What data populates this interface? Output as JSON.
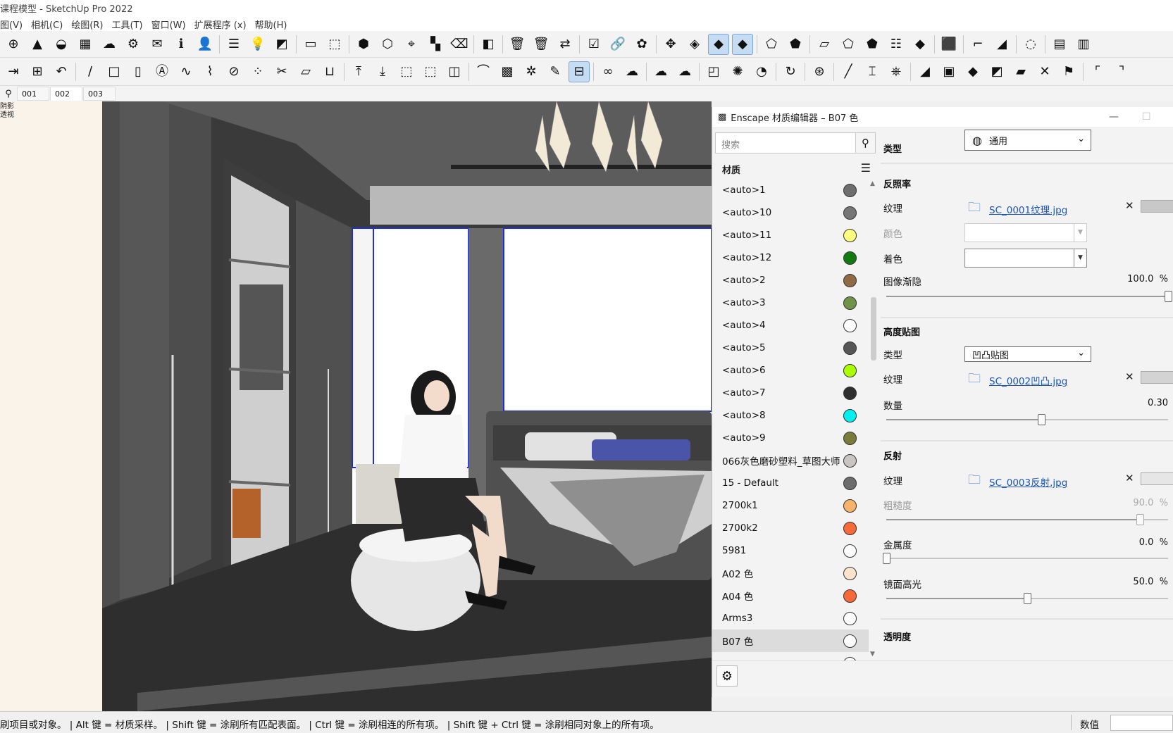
{
  "window": {
    "title": "课程模型 - SketchUp Pro 2022"
  },
  "menu": [
    "图(V)",
    "相机(C)",
    "绘图(R)",
    "工具(T)",
    "窗口(W)",
    "扩展程序 (x)",
    "帮助(H)"
  ],
  "toolbar1": [
    {
      "icon": "add-icon",
      "glyph": "⊕"
    },
    {
      "icon": "tree-icon",
      "glyph": "▲"
    },
    {
      "icon": "warehouse-icon",
      "glyph": "◒"
    },
    {
      "icon": "checker-icon",
      "glyph": "▦"
    },
    {
      "icon": "cloud-upload-icon",
      "glyph": "☁"
    },
    {
      "icon": "extension-gear-icon",
      "glyph": "⚙"
    },
    {
      "icon": "mail-icon",
      "glyph": "✉"
    },
    {
      "icon": "info-icon",
      "glyph": "ℹ"
    },
    {
      "icon": "user-icon",
      "glyph": "👤"
    },
    {
      "sep": true
    },
    {
      "icon": "list-icon",
      "glyph": "☰"
    },
    {
      "icon": "bulb-icon",
      "glyph": "💡"
    },
    {
      "icon": "contrast-icon",
      "glyph": "◩"
    },
    {
      "sep": true
    },
    {
      "icon": "rect-view-icon",
      "glyph": "▭"
    },
    {
      "icon": "frame-icon",
      "glyph": "⬚"
    },
    {
      "sep": true
    },
    {
      "icon": "hexagon-gold-icon",
      "glyph": "⬢"
    },
    {
      "icon": "hexagon-outline-icon",
      "glyph": "⬡"
    },
    {
      "icon": "point-icon",
      "glyph": "⌖"
    },
    {
      "icon": "components-icon",
      "glyph": "▚"
    },
    {
      "icon": "erase-tag-icon",
      "glyph": "⌫"
    },
    {
      "sep": true
    },
    {
      "icon": "split-icon",
      "glyph": "◧"
    },
    {
      "sep": true
    },
    {
      "icon": "trash-red-icon",
      "glyph": "🗑"
    },
    {
      "icon": "trash-blue-icon",
      "glyph": "🗑"
    },
    {
      "icon": "swap-icon",
      "glyph": "⇄"
    },
    {
      "sep": true
    },
    {
      "icon": "check-box-icon",
      "glyph": "☑"
    },
    {
      "icon": "link-icon",
      "glyph": "🔗"
    },
    {
      "icon": "material-m-icon",
      "glyph": "✿"
    },
    {
      "sep": true
    },
    {
      "icon": "move-icon",
      "glyph": "✥"
    },
    {
      "icon": "cube-blue-icon",
      "glyph": "◈"
    },
    {
      "icon": "cube-active-icon",
      "glyph": "◆",
      "active": true
    },
    {
      "icon": "cube-active2-icon",
      "glyph": "◆",
      "active": true
    },
    {
      "sep": true
    },
    {
      "icon": "view-iso-icon",
      "glyph": "⬠"
    },
    {
      "icon": "view-top-icon",
      "glyph": "⬟"
    },
    {
      "sep": true
    },
    {
      "icon": "view-front-icon",
      "glyph": "▱"
    },
    {
      "icon": "view-right-icon",
      "glyph": "⬠"
    },
    {
      "icon": "view-back-icon",
      "glyph": "⬟"
    },
    {
      "icon": "layers-icon",
      "glyph": "☷"
    },
    {
      "icon": "view-left-icon",
      "glyph": "◆"
    },
    {
      "sep": true
    },
    {
      "icon": "cube-red-icon",
      "glyph": "⬛"
    },
    {
      "sep": true
    },
    {
      "icon": "stairs-icon",
      "glyph": "⌐"
    },
    {
      "icon": "ramp-icon",
      "glyph": "◢"
    },
    {
      "sep": true
    },
    {
      "icon": "num-icon",
      "glyph": "◌"
    },
    {
      "sep": true
    },
    {
      "icon": "stack-icon",
      "glyph": "▤"
    },
    {
      "icon": "stack2-icon",
      "glyph": "▥"
    }
  ],
  "toolbar2": [
    {
      "icon": "door-icon",
      "glyph": "⇥"
    },
    {
      "icon": "window-icon",
      "glyph": "⊞"
    },
    {
      "icon": "undo-arc-icon",
      "glyph": "↶"
    },
    {
      "sep": true
    },
    {
      "icon": "line-icon",
      "glyph": "∕"
    },
    {
      "icon": "rectangle-icon",
      "glyph": "□"
    },
    {
      "icon": "book-icon",
      "glyph": "▯"
    },
    {
      "icon": "text-a-icon",
      "glyph": "Ⓐ"
    },
    {
      "icon": "curve-icon",
      "glyph": "∿"
    },
    {
      "icon": "polyline-icon",
      "glyph": "⌇"
    },
    {
      "icon": "slash-icon",
      "glyph": "⊘"
    },
    {
      "icon": "grid-points-icon",
      "glyph": "⁘"
    },
    {
      "icon": "trim-icon",
      "glyph": "✂"
    },
    {
      "icon": "surface-icon",
      "glyph": "▱"
    },
    {
      "icon": "basket-icon",
      "glyph": "⊔"
    },
    {
      "sep": true
    },
    {
      "icon": "push-up-icon",
      "glyph": "⤒"
    },
    {
      "icon": "push-down-icon",
      "glyph": "⤓"
    },
    {
      "icon": "box-icon",
      "glyph": "⬚"
    },
    {
      "icon": "dotted-box-icon",
      "glyph": "⬚"
    },
    {
      "icon": "plane-icon",
      "glyph": "◫"
    },
    {
      "sep": true
    },
    {
      "icon": "arc-icon",
      "glyph": "⌒"
    },
    {
      "icon": "pattern-icon",
      "glyph": "▩"
    },
    {
      "icon": "shape-x-icon",
      "glyph": "✲"
    },
    {
      "icon": "tool-pin-icon",
      "glyph": "✎"
    },
    {
      "icon": "select-active-icon",
      "glyph": "⊟",
      "active": true
    },
    {
      "sep": true
    },
    {
      "icon": "weld-icon",
      "glyph": "∞"
    },
    {
      "icon": "cloud-link-icon",
      "glyph": "☁"
    },
    {
      "sep": true
    },
    {
      "icon": "cloud-a-icon",
      "glyph": "☁"
    },
    {
      "icon": "cloud-b-icon",
      "glyph": "☁"
    },
    {
      "sep": true
    },
    {
      "icon": "rotate-box-icon",
      "glyph": "◰"
    },
    {
      "icon": "scatter-icon",
      "glyph": "✺"
    },
    {
      "icon": "dial-icon",
      "glyph": "◔"
    },
    {
      "sep": true
    },
    {
      "icon": "refresh-circle-icon",
      "glyph": "↻"
    },
    {
      "sep": true
    },
    {
      "icon": "wheel-icon",
      "glyph": "⊛"
    },
    {
      "sep": true
    },
    {
      "icon": "knife-icon",
      "glyph": "╱"
    },
    {
      "icon": "frame-tool-icon",
      "glyph": "⌶"
    },
    {
      "icon": "brush-icon",
      "glyph": "⎈"
    },
    {
      "sep": true
    },
    {
      "icon": "eraser-icon",
      "glyph": "◢"
    },
    {
      "icon": "box-orange-icon",
      "glyph": "▣"
    },
    {
      "icon": "shapes-icon",
      "glyph": "◆"
    },
    {
      "icon": "fold-icon",
      "glyph": "◩"
    },
    {
      "icon": "cut-orange-icon",
      "glyph": "▰"
    },
    {
      "icon": "cross-icon",
      "glyph": "✕"
    },
    {
      "icon": "flag-icon",
      "glyph": "⚑"
    },
    {
      "sep": true
    },
    {
      "icon": "corner-a-icon",
      "glyph": "⌜"
    },
    {
      "icon": "corner-b-icon",
      "glyph": "⌝"
    }
  ],
  "scene_tabs": [
    "001",
    "002",
    "003"
  ],
  "active_scene": "002",
  "viewport": {
    "labels": [
      "阴影",
      "透视"
    ]
  },
  "editor": {
    "title": "Enscape 材质编辑器 – B07 色",
    "search_placeholder": "搜索",
    "materials_header": "材质",
    "materials": [
      {
        "name": "<auto>1",
        "color": "#6e6e6e"
      },
      {
        "name": "<auto>10",
        "color": "#767676"
      },
      {
        "name": "<auto>11",
        "color": "#ffff80"
      },
      {
        "name": "<auto>12",
        "color": "#127a12"
      },
      {
        "name": "<auto>2",
        "color": "#8f6a45"
      },
      {
        "name": "<auto>3",
        "color": "#6f9448"
      },
      {
        "name": "<auto>4",
        "color": "#ffffff"
      },
      {
        "name": "<auto>5",
        "color": "#565656"
      },
      {
        "name": "<auto>6",
        "color": "#aaff00"
      },
      {
        "name": "<auto>7",
        "color": "#2e2e2e"
      },
      {
        "name": "<auto>8",
        "color": "#00f0f0"
      },
      {
        "name": "<auto>9",
        "color": "#7a7a3a"
      },
      {
        "name": "066灰色磨砂塑料_草图大师",
        "color": "#c8c6c2"
      },
      {
        "name": "15 - Default",
        "color": "#6c6c6c"
      },
      {
        "name": "2700k1",
        "color": "#f7b36b"
      },
      {
        "name": "2700k2",
        "color": "#f76b3b"
      },
      {
        "name": "5981",
        "color": "#ffffff"
      },
      {
        "name": "A02 色",
        "color": "#fde3cc"
      },
      {
        "name": "A04 色",
        "color": "#f8693a"
      },
      {
        "name": "Arms3",
        "color": "#ffffff"
      },
      {
        "name": "B07 色",
        "color": "#ffffff",
        "selected": true
      },
      {
        "name": "",
        "color": "#ffffff"
      }
    ],
    "type_label": "类型",
    "type_value": "通用",
    "albedo": {
      "title": "反照率",
      "texture_label": "纹理",
      "texture_file": "SC_0001纹理.jpg",
      "color_label": "颜色",
      "tint_label": "着色",
      "fade_label": "图像渐隐",
      "fade_value": "100.0",
      "fade_pct": 1.0
    },
    "height": {
      "title": "高度贴图",
      "type_label": "类型",
      "type_value": "凹凸贴图",
      "texture_label": "纹理",
      "texture_file": "SC_0002凹凸.jpg",
      "amount_label": "数量",
      "amount_value": "0.30",
      "amount_pct": 0.55
    },
    "reflection": {
      "title": "反射",
      "texture_label": "纹理",
      "texture_file": "SC_0003反射.jpg",
      "roughness_label": "粗糙度",
      "roughness_value": "90.0",
      "roughness_pct": 0.9,
      "metallic_label": "金属度",
      "metallic_value": "0.0",
      "metallic_pct": 0.0,
      "specular_label": "镜面高光",
      "specular_value": "50.0",
      "specular_pct": 0.5
    },
    "transparency_title": "透明度",
    "pct_unit": "%"
  },
  "status": {
    "message": "刷项目或对象。 | Alt 键 = 材质采样。 | Shift 键 = 涂刷所有匹配表面。 | Ctrl 键 = 涂刷相连的所有项。 | Shift 键 + Ctrl 键 = 涂刷相同对象上的所有项。",
    "value_label": "数值"
  }
}
